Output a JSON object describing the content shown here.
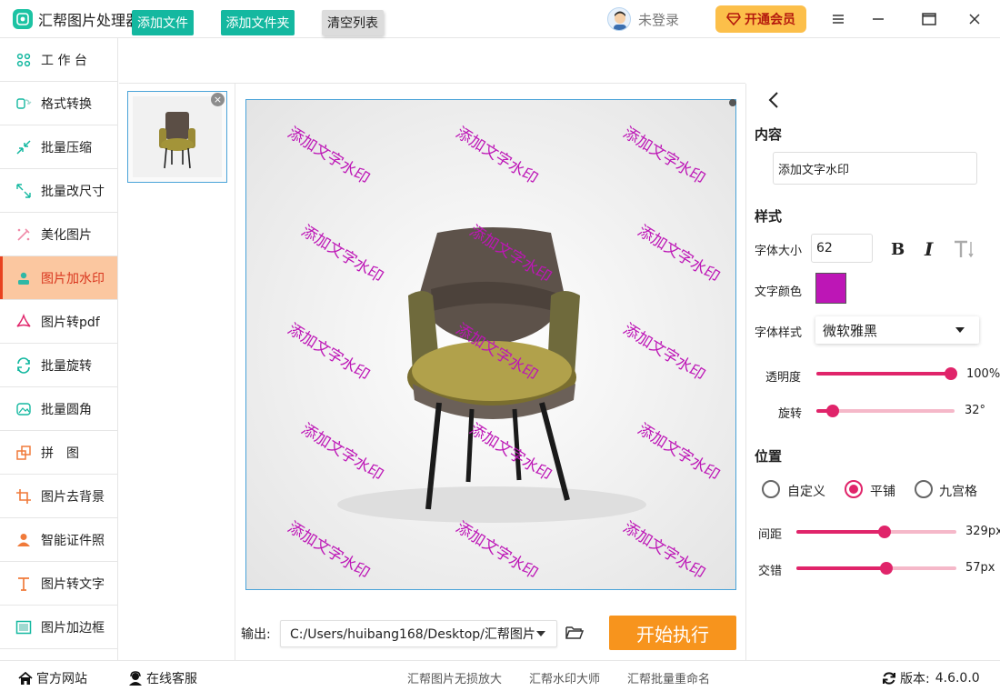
{
  "app": {
    "title": "汇帮图片处理器"
  },
  "user": {
    "login_text": "未登录",
    "vip_label": "开通会员"
  },
  "sidebar": {
    "items": [
      {
        "label": "工 作 台",
        "icon": "grid-icon"
      },
      {
        "label": "格式转换",
        "icon": "convert-icon"
      },
      {
        "label": "批量压缩",
        "icon": "compress-icon"
      },
      {
        "label": "批量改尺寸",
        "icon": "resize-icon"
      },
      {
        "label": "美化图片",
        "icon": "beautify-icon"
      },
      {
        "label": "图片加水印",
        "icon": "watermark-icon"
      },
      {
        "label": "图片转pdf",
        "icon": "pdf-icon"
      },
      {
        "label": "批量旋转",
        "icon": "rotate-icon"
      },
      {
        "label": "批量圆角",
        "icon": "round-corner-icon"
      },
      {
        "label": "拼　图",
        "icon": "puzzle-icon"
      },
      {
        "label": "图片去背景",
        "icon": "crop-icon"
      },
      {
        "label": "智能证件照",
        "icon": "person-icon"
      },
      {
        "label": "图片转文字",
        "icon": "text-icon"
      },
      {
        "label": "图片加边框",
        "icon": "frame-icon"
      }
    ],
    "active_index": 5
  },
  "toolbar": {
    "add_file": "添加文件",
    "add_folder": "添加文件夹",
    "clear_list": "清空列表"
  },
  "preview": {
    "watermark_text": "添加文字水印"
  },
  "output": {
    "label": "输出:",
    "path": "C:/Users/huibang168/Desktop/汇帮图片",
    "start_label": "开始执行"
  },
  "panel": {
    "content_title": "内容",
    "content_value": "添加文字水印",
    "style_title": "样式",
    "font_size_label": "字体大小",
    "font_size_value": "62",
    "bold_label": "B",
    "italic_label": "I",
    "text_color_label": "文字颜色",
    "text_color": "#bd16b6",
    "font_style_label": "字体样式",
    "font_style_value": "微软雅黑",
    "opacity_label": "透明度",
    "opacity_value": "100%",
    "opacity_fraction": 1.0,
    "rotation_label": "旋转",
    "rotation_value": "32°",
    "rotation_fraction": 0.12,
    "position_title": "位置",
    "position_options": [
      "自定义",
      "平铺",
      "九宫格"
    ],
    "position_selected": 1,
    "spacing_label": "间距",
    "spacing_value": "329px",
    "spacing_fraction": 0.55,
    "offset_label": "交错",
    "offset_value": "57px",
    "offset_fraction": 0.56
  },
  "footer": {
    "website": "官方网站",
    "support": "在线客服",
    "links": [
      "汇帮图片无损放大",
      "汇帮水印大师",
      "汇帮批量重命名"
    ],
    "version_label": "版本:",
    "version_value": "4.6.0.0"
  },
  "colors": {
    "accent": "#e0246a",
    "green": "#14b8a0",
    "orange": "#f7941d",
    "active_bg": "#fbc7a0"
  }
}
